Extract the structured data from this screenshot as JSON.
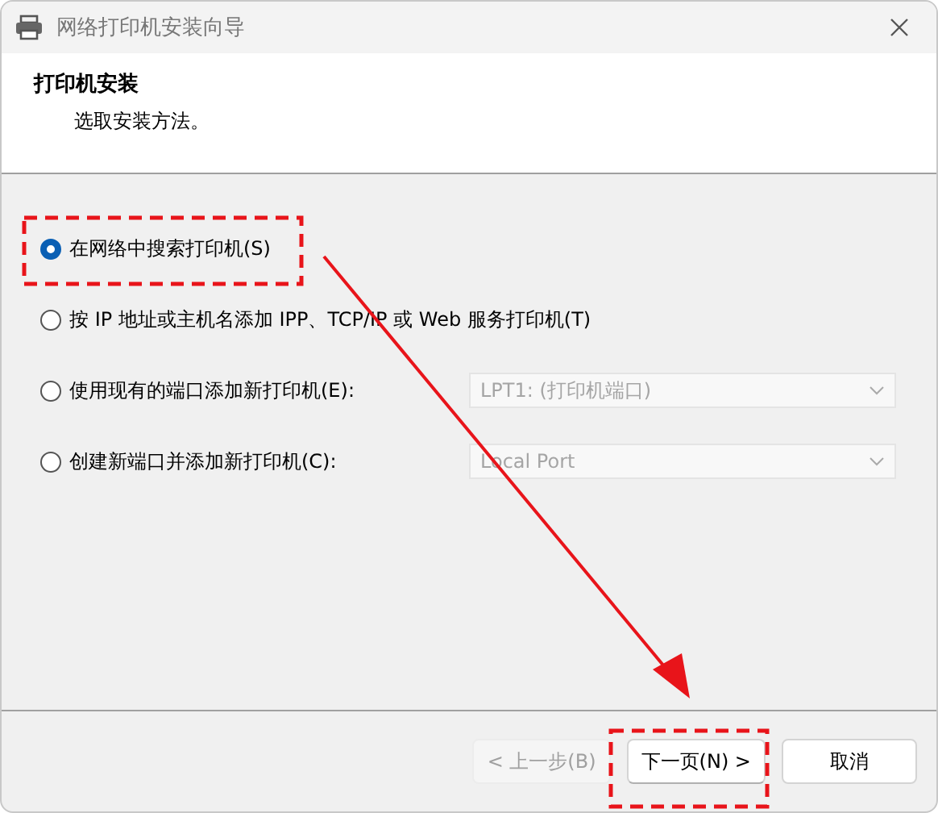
{
  "window": {
    "title": "网络打印机安装向导"
  },
  "header": {
    "title": "打印机安装",
    "subtitle": "选取安装方法。"
  },
  "options": [
    {
      "label": "在网络中搜索打印机(S)",
      "selected": true
    },
    {
      "label": "按 IP 地址或主机名添加 IPP、TCP/IP 或 Web 服务打印机(T)",
      "selected": false
    },
    {
      "label": "使用现有的端口添加新打印机(E):",
      "selected": false,
      "dropdown": {
        "value": "LPT1: (打印机端口)",
        "disabled": true
      }
    },
    {
      "label": "创建新端口并添加新打印机(C):",
      "selected": false,
      "dropdown": {
        "value": "Local Port",
        "disabled": true
      }
    }
  ],
  "buttons": [
    {
      "label": "< 上一步(B)",
      "disabled": true,
      "highlighted": false
    },
    {
      "label": "下一页(N) >",
      "disabled": false,
      "highlighted": true
    },
    {
      "label": "取消",
      "disabled": false,
      "highlighted": false
    }
  ]
}
